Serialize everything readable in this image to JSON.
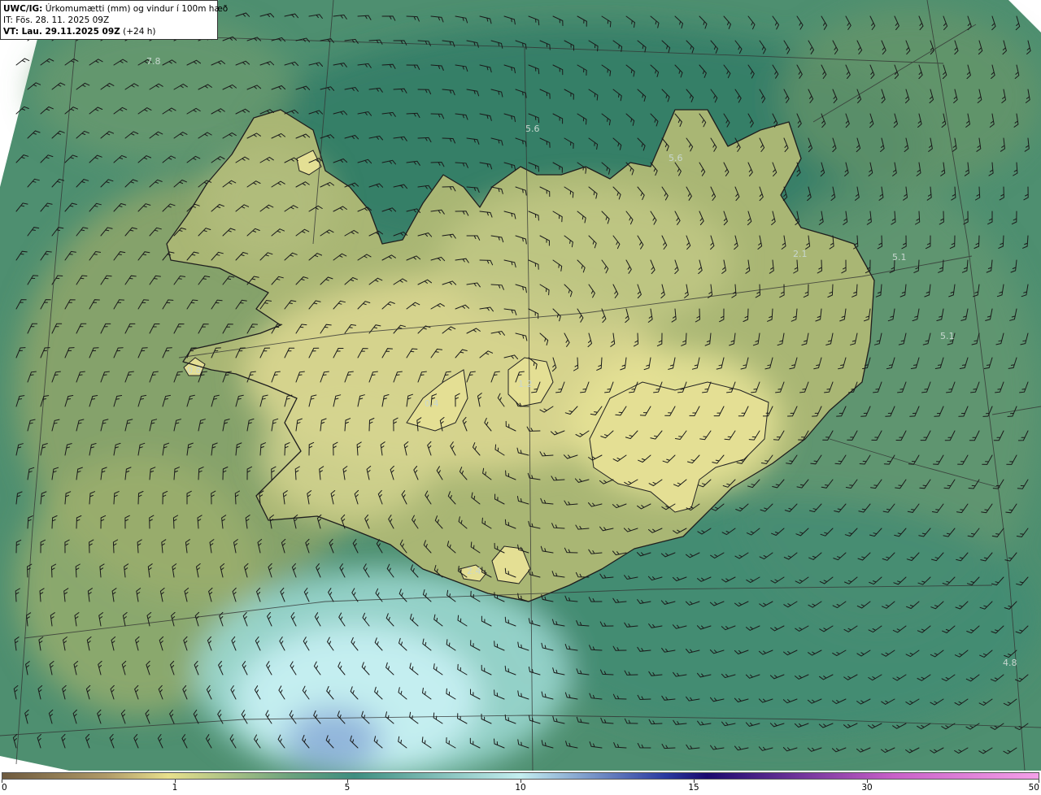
{
  "header": {
    "product": "UWC/IG:",
    "description": "Úrkomumætti (mm) og vindur í 100m hæð",
    "init_time": "IT: Fös. 28. 11. 2025 09Z",
    "valid_label": "VT: Lau. 29.11.2025 09Z",
    "valid_offset": "(+24 h)"
  },
  "map_labels": [
    {
      "id": "label-1",
      "text": "7.8"
    },
    {
      "id": "label-2",
      "text": "5.6"
    },
    {
      "id": "label-3",
      "text": "5.6"
    },
    {
      "id": "label-4",
      "text": "2.1"
    },
    {
      "id": "label-5",
      "text": "5.1"
    },
    {
      "id": "label-6",
      "text": "5.1"
    },
    {
      "id": "label-7",
      "text": "0.8"
    },
    {
      "id": "label-8",
      "text": "0.4"
    },
    {
      "id": "label-9",
      "text": "1.2"
    },
    {
      "id": "label-10",
      "text": "2.4"
    },
    {
      "id": "label-11",
      "text": "4.8"
    }
  ],
  "colorbar": {
    "unit": "mm",
    "ticks": [
      {
        "value": "0"
      },
      {
        "value": "1"
      },
      {
        "value": "5"
      },
      {
        "value": "10"
      },
      {
        "value": "15"
      },
      {
        "value": "30"
      },
      {
        "value": "50"
      }
    ],
    "colors": [
      "#6e5a3e",
      "#b09a68",
      "#e8e08c",
      "#6aa27e",
      "#3e8e80",
      "#c4eef0",
      "#2a3aa0",
      "#1a0a6e",
      "#c860c8",
      "#f4a0e8"
    ]
  },
  "colors": {
    "sea_dark": "#2f7a68",
    "sea_mid": "#3f8a70",
    "land_low": "#8aa86a",
    "land_high": "#e0de92",
    "sea_bright": "#c6eef2",
    "coast_line": "#1e1e1e",
    "grid_line": "#333333",
    "label_color": "#c8d7cf"
  }
}
